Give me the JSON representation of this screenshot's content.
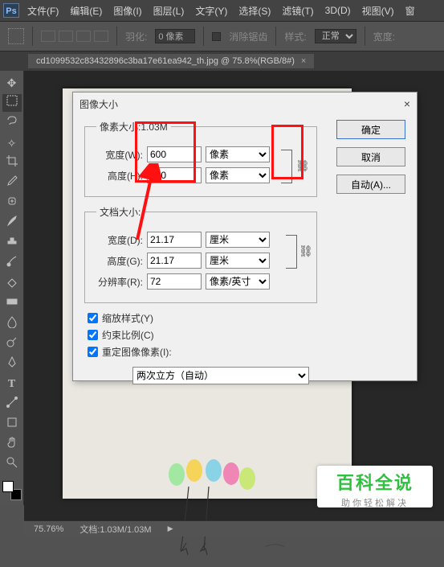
{
  "app": {
    "logo": "Ps"
  },
  "menu": {
    "file": "文件(F)",
    "edit": "编辑(E)",
    "image": "图像(I)",
    "layer": "图层(L)",
    "type": "文字(Y)",
    "select": "选择(S)",
    "filter": "滤镜(T)",
    "threeD": "3D(D)",
    "view": "视图(V)",
    "window": "窗"
  },
  "options": {
    "feather_label": "羽化:",
    "feather_value": "0 像素",
    "antialias": "消除锯齿",
    "style_label": "样式:",
    "style_value": "正常",
    "width_label": "宽度:"
  },
  "tab": {
    "title": "cd1099532c83432896c3ba17e61ea942_th.jpg @ 75.8%(RGB/8#)"
  },
  "dialog": {
    "title": "图像大小",
    "pixel_group_legend": "像素大小:1.03M",
    "width_label": "宽度(W):",
    "width_value": "600",
    "height_label": "高度(H):",
    "height_value": "600",
    "unit_px": "像素",
    "doc_group_legend": "文档大小:",
    "doc_width_label": "宽度(D):",
    "doc_width_value": "21.17",
    "doc_height_label": "高度(G):",
    "doc_height_value": "21.17",
    "unit_cm": "厘米",
    "res_label": "分辨率(R):",
    "res_value": "72",
    "unit_ppi": "像素/英寸",
    "chk_scale": "缩放样式(Y)",
    "chk_constrain": "约束比例(C)",
    "chk_resample": "重定图像像素(I):",
    "interp": "两次立方（自动）",
    "btn_ok": "确定",
    "btn_cancel": "取消",
    "btn_auto": "自动(A)..."
  },
  "status": {
    "zoom": "75.76%",
    "docinfo": "文档:1.03M/1.03M"
  },
  "watermark": {
    "big": "百科全说",
    "small": "助你轻松解决"
  }
}
